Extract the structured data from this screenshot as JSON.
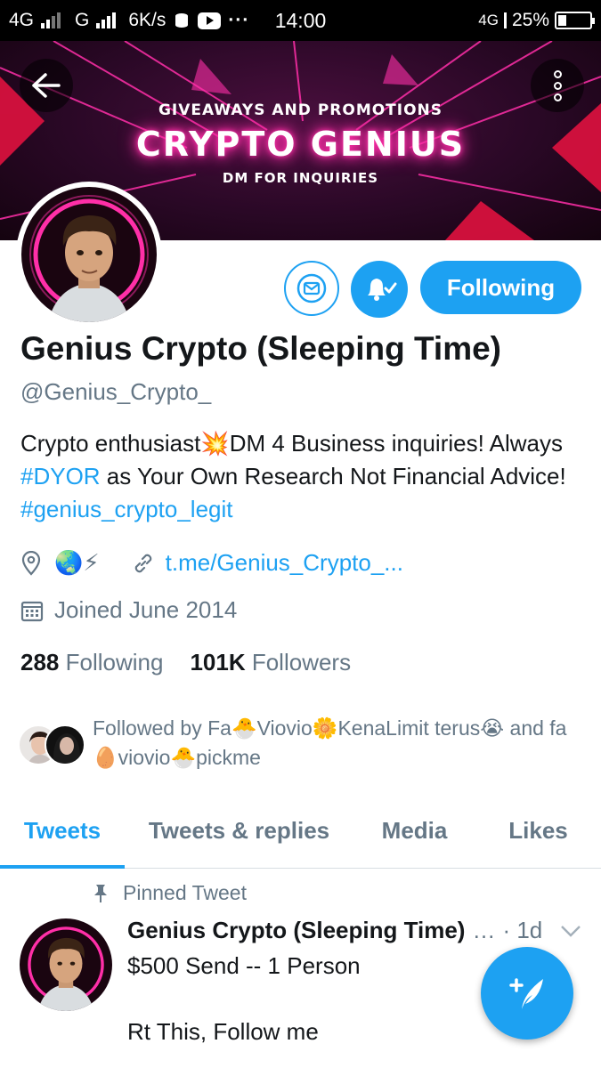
{
  "status_bar": {
    "network1": "4G",
    "network2": "G",
    "speed": "6K/s",
    "time": "14:00",
    "network3": "4G",
    "battery": "25%",
    "battery_level": 0.25
  },
  "banner": {
    "subtitle": "GIVEAWAYS AND PROMOTIONS",
    "title": "CRYPTO GENIUS",
    "caption": "DM FOR INQUIRIES"
  },
  "profile": {
    "follow_button": "Following",
    "name": "Genius Crypto (Sleeping Time)",
    "handle": "@Genius_Crypto_",
    "bio": {
      "p1": "Crypto enthusiast",
      "emoji1": "💥",
      "p2": "DM 4 Business inquiries! Always ",
      "tag1": "#DYOR",
      "p3": " as Your Own Research Not Financial Advice! ",
      "tag2": "#genius_crypto_legit"
    },
    "location": "🌏⚡",
    "website": "t.me/Genius_Crypto_...",
    "joined": "Joined June 2014",
    "following_count": "288",
    "following_label": "Following",
    "followers_count": "101K",
    "followers_label": "Followers",
    "followed_by": "Followed by Fa🐣Viovio🌼KenaLimit terus😭 and fa🥚viovio🐣pickme"
  },
  "tabs": [
    {
      "label": "Tweets",
      "active": true
    },
    {
      "label": "Tweets & replies",
      "active": false
    },
    {
      "label": "Media",
      "active": false
    },
    {
      "label": "Likes",
      "active": false
    }
  ],
  "tweet": {
    "pinned_label": "Pinned Tweet",
    "name": "Genius Crypto (Sleeping Time)",
    "ellipsis": "…",
    "time": "· 1d",
    "line1": "$500 Send -- 1 Person",
    "line2": "Rt This, Follow me"
  },
  "icons": {
    "back": "back-arrow-icon",
    "more": "more-vertical-icon",
    "message": "envelope-icon",
    "notifications": "bell-check-icon",
    "location": "location-pin-icon",
    "link": "link-icon",
    "calendar": "calendar-icon",
    "pin": "pin-icon",
    "chevron": "chevron-down-icon",
    "compose": "compose-tweet-icon"
  },
  "colors": {
    "accent": "#1da1f2",
    "secondary_text": "#657786",
    "neon_pink": "#ff2fa8"
  }
}
